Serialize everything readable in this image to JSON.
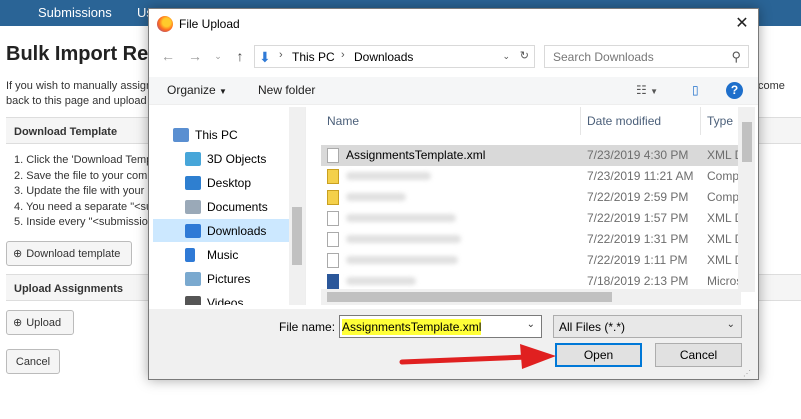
{
  "webpage": {
    "nav": [
      "Submissions",
      "Us"
    ],
    "title": "Bulk Import Rev",
    "intro_lines": [
      "If you wish to manually assign",
      "back to this page and upload f"
    ],
    "intro_right": "come",
    "download_panel": "Download Template",
    "steps": [
      "1. Click the 'Download Templ",
      "2. Save the file to your comp",
      "3. Update the file with your",
      "4. You need a separate \"<su",
      "5. Inside every \"<submission"
    ],
    "download_button": "Download template",
    "upload_panel": "Upload Assignments",
    "upload_button": "Upload",
    "cancel_button": "Cancel"
  },
  "dialog": {
    "title": "File Upload",
    "address": [
      "This PC",
      "Downloads"
    ],
    "search_placeholder": "Search Downloads",
    "toolbar": {
      "organize": "Organize",
      "new_folder": "New folder"
    },
    "nav_items": [
      {
        "label": "This PC",
        "icon": "pc-icon",
        "color": "#5a8fd1"
      },
      {
        "label": "3D Objects",
        "icon": "cube-icon",
        "color": "#47a6d9"
      },
      {
        "label": "Desktop",
        "icon": "desktop-icon",
        "color": "#2e7fd0"
      },
      {
        "label": "Documents",
        "icon": "documents-icon",
        "color": "#9aa9b8"
      },
      {
        "label": "Downloads",
        "icon": "download-icon",
        "color": "#2f7ad6"
      },
      {
        "label": "Music",
        "icon": "music-icon",
        "color": "#2f7ad6"
      },
      {
        "label": "Pictures",
        "icon": "pictures-icon",
        "color": "#7aa9cf"
      },
      {
        "label": "Videos",
        "icon": "videos-icon",
        "color": "#555555"
      }
    ],
    "columns": {
      "name": "Name",
      "date": "Date modified",
      "type": "Type"
    },
    "files": [
      {
        "name": "AssignmentsTemplate.xml",
        "date": "7/23/2019 4:30 PM",
        "type": "XML D",
        "icon": "xml",
        "selected": true
      },
      {
        "name": "",
        "date": "7/23/2019 11:21 AM",
        "type": "Comp",
        "icon": "zip"
      },
      {
        "name": "",
        "date": "7/22/2019 2:59 PM",
        "type": "Comp",
        "icon": "zip"
      },
      {
        "name": "",
        "date": "7/22/2019 1:57 PM",
        "type": "XML D",
        "icon": "xml"
      },
      {
        "name": "",
        "date": "7/22/2019 1:31 PM",
        "type": "XML D",
        "icon": "xml"
      },
      {
        "name": "",
        "date": "7/22/2019 1:11 PM",
        "type": "XML D",
        "icon": "xml"
      },
      {
        "name": "",
        "date": "7/18/2019 2:13 PM",
        "type": "Micros",
        "icon": "word"
      }
    ],
    "file_name_label": "File name:",
    "file_name_value": "AssignmentsTemplate.xml",
    "file_type": "All Files (*.*)",
    "open_button": "Open",
    "cancel_button": "Cancel"
  },
  "annotation": {
    "arrow_color": "#e02020",
    "highlight_color": "#ffff38"
  }
}
